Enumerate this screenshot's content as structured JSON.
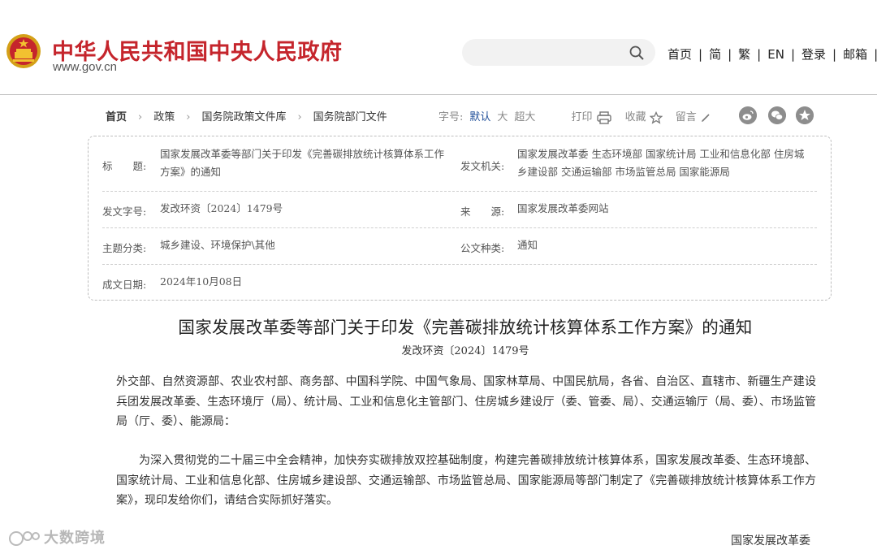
{
  "header": {
    "site_title": "中华人民共和国中央人民政府",
    "site_url": "www.gov.cn",
    "search_placeholder": "",
    "nav": [
      "首页",
      "简",
      "繁",
      "EN",
      "登录",
      "邮箱"
    ]
  },
  "breadcrumb": [
    "首页",
    "政策",
    "国务院政策文件库",
    "国务院部门文件"
  ],
  "tools": {
    "font_label": "字号:",
    "font_default": "默认",
    "font_large": "大",
    "font_xlarge": "超大",
    "print": "打印",
    "favorite": "收藏",
    "comment": "留言"
  },
  "info": {
    "title_label": "标　　题:",
    "title_value": "国家发展改革委等部门关于印发《完善碳排放统计核算体系工作方案》的通知",
    "issuer_label": "发文机关:",
    "issuer_value": "国家发展改革委 生态环境部 国家统计局 工业和信息化部 住房城乡建设部 交通运输部 市场监管总局 国家能源局",
    "docno_label": "发文字号:",
    "docno_value": "发改环资〔2024〕1479号",
    "source_label": "来　　源:",
    "source_value": "国家发展改革委网站",
    "topic_label": "主题分类:",
    "topic_value": "城乡建设、环境保护\\其他",
    "type_label": "公文种类:",
    "type_value": "通知",
    "date_label": "成文日期:",
    "date_value": "2024年10月08日"
  },
  "article": {
    "title": "国家发展改革委等部门关于印发《完善碳排放统计核算体系工作方案》的通知",
    "docno": "发改环资〔2024〕1479号",
    "recipients": "外交部、自然资源部、农业农村部、商务部、中国科学院、中国气象局、国家林草局、中国民航局，各省、自治区、直辖市、新疆生产建设兵团发展改革委、生态环境厅（局）、统计局、工业和信息化主管部门、住房城乡建设厅（委、管委、局）、交通运输厅（局、委）、市场监管局（厅、委）、能源局：",
    "body": "为深入贯彻党的二十届三中全会精神，加快夯实碳排放双控基础制度，构建完善碳排放统计核算体系，国家发展改革委、生态环境部、国家统计局、工业和信息化部、住房城乡建设部、交通运输部、市场监管总局、国家能源局等部门制定了《完善碳排放统计核算体系工作方案》，现印发给你们，请结合实际抓好落实。",
    "signature": "国家发展改革委"
  },
  "watermark": "大数跨境",
  "colors": {
    "brand_red": "#c5252c",
    "active_blue": "#1f4e99"
  }
}
